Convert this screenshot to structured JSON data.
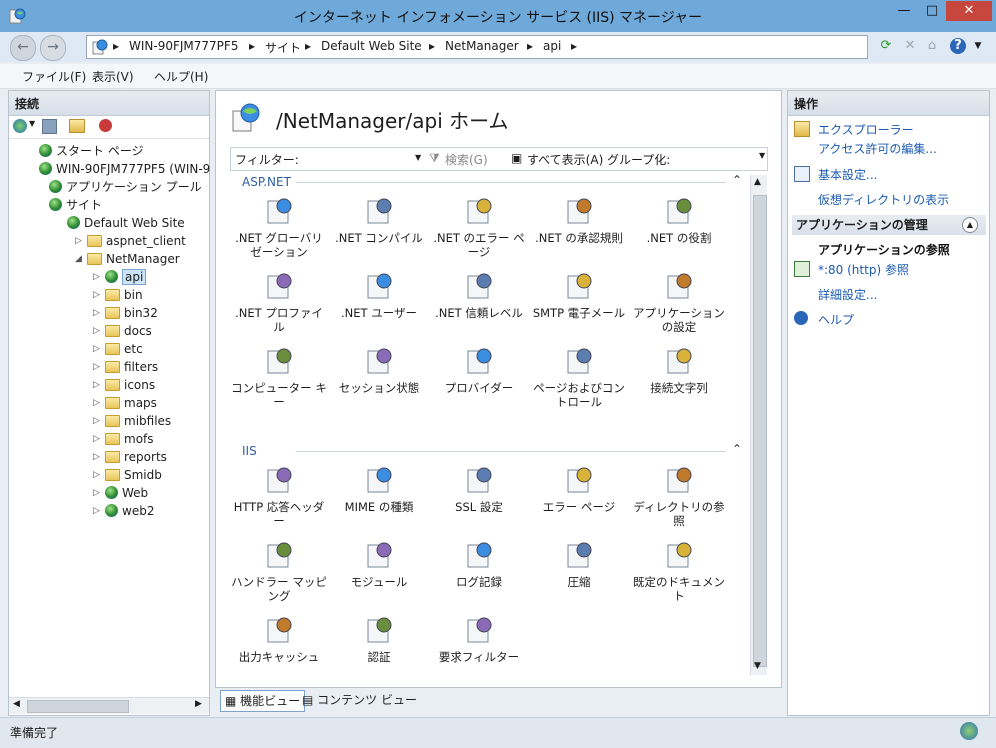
{
  "window": {
    "title": "インターネット インフォメーション サービス (IIS) マネージャー",
    "min": "—",
    "max": "□",
    "close": "✕"
  },
  "address": {
    "crumbs": [
      "WIN-90FJM777PF5",
      "サイト",
      "Default Web Site",
      "NetManager",
      "api"
    ],
    "sep": "▸"
  },
  "menu": [
    "ファイル(F)",
    "表示(V)",
    "ヘルプ(H)"
  ],
  "connections": {
    "header": "接続",
    "tree": [
      {
        "label": "スタート ページ",
        "icon": "start-page-icon",
        "depth": 1
      },
      {
        "label": "WIN-90FJM777PF5 (WIN-9",
        "icon": "server-icon",
        "depth": 1
      },
      {
        "label": "アプリケーション プール",
        "icon": "app-pool-icon",
        "depth": 2
      },
      {
        "label": "サイト",
        "icon": "sites-icon",
        "depth": 2
      },
      {
        "label": "Default Web Site",
        "icon": "globe-icon",
        "depth": 3
      },
      {
        "label": "aspnet_client",
        "icon": "folder-icon",
        "depth": 4
      },
      {
        "label": "NetManager",
        "icon": "folder-icon",
        "depth": 4
      },
      {
        "label": "api",
        "icon": "web-app-icon",
        "depth": 5,
        "selected": true
      },
      {
        "label": "bin",
        "icon": "folder-icon",
        "depth": 5
      },
      {
        "label": "bin32",
        "icon": "folder-icon",
        "depth": 5
      },
      {
        "label": "docs",
        "icon": "folder-icon",
        "depth": 5
      },
      {
        "label": "etc",
        "icon": "folder-icon",
        "depth": 5
      },
      {
        "label": "filters",
        "icon": "folder-icon",
        "depth": 5
      },
      {
        "label": "icons",
        "icon": "folder-icon",
        "depth": 5
      },
      {
        "label": "maps",
        "icon": "folder-icon",
        "depth": 5
      },
      {
        "label": "mibfiles",
        "icon": "folder-icon",
        "depth": 5
      },
      {
        "label": "mofs",
        "icon": "folder-icon",
        "depth": 5
      },
      {
        "label": "reports",
        "icon": "folder-icon",
        "depth": 5
      },
      {
        "label": "Smidb",
        "icon": "folder-icon",
        "depth": 5
      },
      {
        "label": "Web",
        "icon": "web-app-icon",
        "depth": 5
      },
      {
        "label": "web2",
        "icon": "web-app-icon",
        "depth": 5
      }
    ]
  },
  "main": {
    "title": "/NetManager/api ホーム",
    "filter_label": "フィルター:",
    "search_label": "検索(G)",
    "show_all_label": "すべて表示(A)",
    "group_label": "グループ化:",
    "sections": [
      {
        "name": "ASP.NET",
        "items": [
          ".NET グローバリゼーション",
          ".NET コンパイル",
          ".NET のエラー ページ",
          ".NET の承認規則",
          ".NET の役割",
          ".NET プロファイル",
          ".NET ユーザー",
          ".NET 信頼レベル",
          "SMTP 電子メール",
          "アプリケーションの設定",
          "コンピューター キー",
          "セッション状態",
          "プロバイダー",
          "ページおよびコントロール",
          "接続文字列"
        ]
      },
      {
        "name": "IIS",
        "items": [
          "HTTP 応答ヘッダー",
          "MIME の種類",
          "SSL 設定",
          "エラー ページ",
          "ディレクトリの参照",
          "ハンドラー マッピング",
          "モジュール",
          "ログ記録",
          "圧縮",
          "既定のドキュメント",
          "出力キャッシュ",
          "認証",
          "要求フィルター"
        ]
      }
    ],
    "tabs": [
      "機能ビュー",
      "コンテンツ ビュー"
    ]
  },
  "actions": {
    "header": "操作",
    "explore": "エクスプローラー",
    "edit_permissions": "アクセス許可の編集...",
    "basic_settings": "基本設定...",
    "view_vdirs": "仮想ディレクトリの表示",
    "app_manage_header": "アプリケーションの管理",
    "browse_header": "アプリケーションの参照",
    "browse_link": "*:80 (http) 参照",
    "advanced": "詳細設定...",
    "help": "ヘルプ"
  },
  "status": {
    "text": "準備完了"
  },
  "colors": {
    "title_bar": "#6ea9d9",
    "link": "#1c5bb0",
    "close": "#c7463d"
  }
}
